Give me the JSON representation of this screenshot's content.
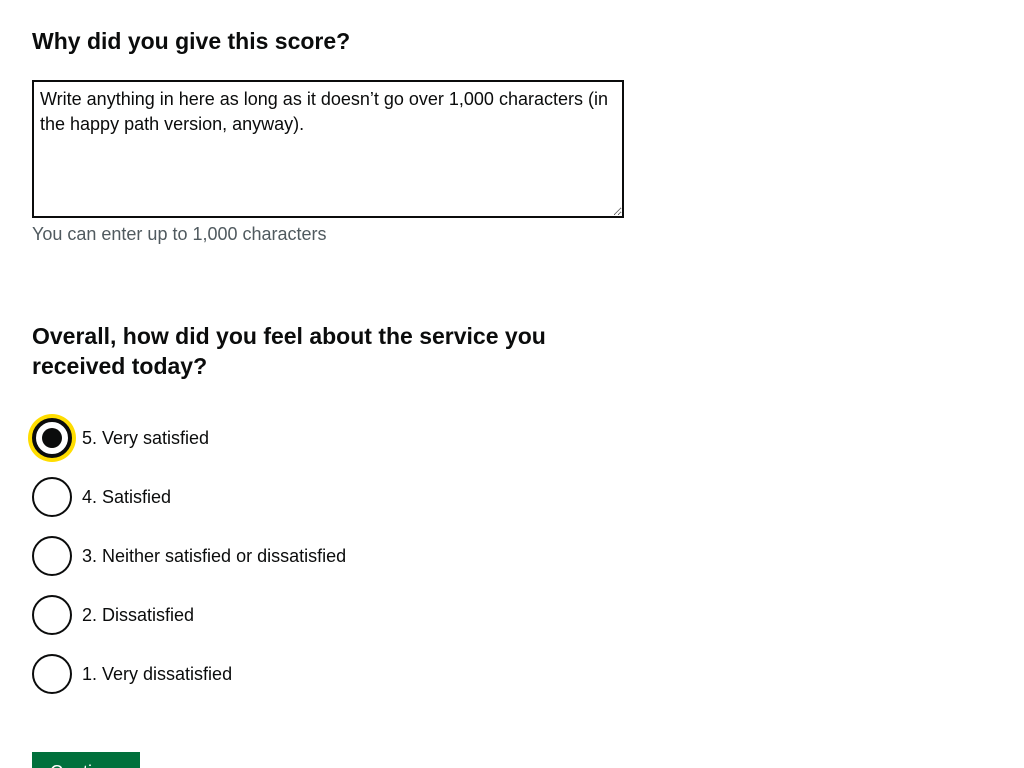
{
  "score_reason": {
    "heading": "Why did you give this score?",
    "textarea_value": "Write anything in here as long as it doesn’t go over 1,000 characters (in the happy path version, anyway).",
    "hint": "You can enter up to 1,000 characters"
  },
  "satisfaction": {
    "heading": "Overall, how did you feel about the service you received today?",
    "options": [
      {
        "label": "5. Very satisfied",
        "checked": true
      },
      {
        "label": "4. Satisfied",
        "checked": false
      },
      {
        "label": "3. Neither satisfied or dissatisfied",
        "checked": false
      },
      {
        "label": "2. Dissatisfied",
        "checked": false
      },
      {
        "label": "1. Very dissatisfied",
        "checked": false
      }
    ]
  },
  "actions": {
    "continue_label": "Continue"
  },
  "colors": {
    "text": "#0b0c0c",
    "hint": "#505a5f",
    "focus": "#ffdd00",
    "button": "#00703c"
  }
}
